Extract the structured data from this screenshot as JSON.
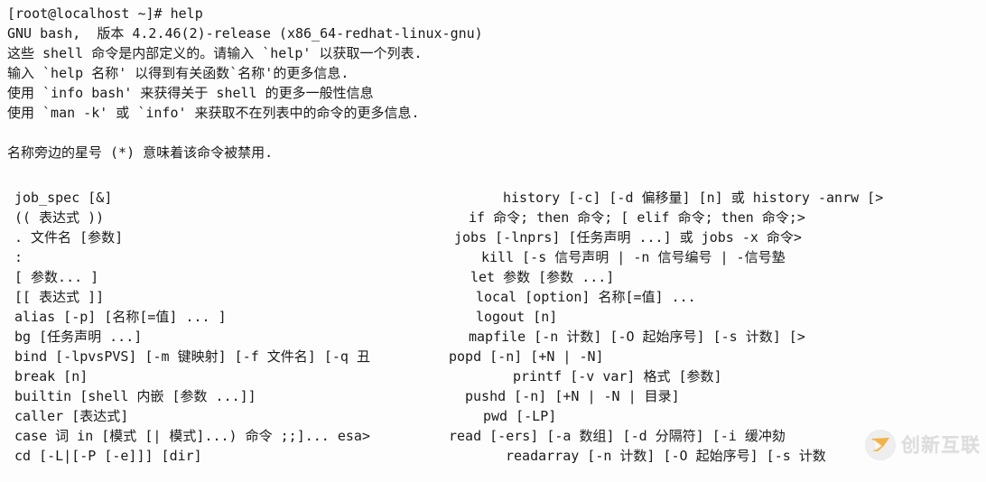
{
  "terminal": {
    "prompt_line": "[root@localhost ~]# help",
    "header_lines": [
      "GNU bash,  版本 4.2.46(2)-release (x86_64-redhat-linux-gnu)",
      "这些 shell 命令是内部定义的。请输入 `help' 以获取一个列表.",
      "输入 `help 名称' 以得到有关函数`名称'的更多信息.",
      "使用 `info bash' 来获得关于 shell 的更多一般性信息",
      "使用 `man -k' 或 `info' 来获取不在列表中的命令的更多信息."
    ],
    "note_line": "名称旁边的星号 (*) 意味着该命令被禁用.",
    "left_column": [
      "job_spec [&]",
      "(( 表达式 ))",
      ". 文件名 [参数]",
      ":",
      "[ 参数... ]",
      "[[ 表达式 ]]",
      "alias [-p] [名称[=值] ... ]",
      "bg [任务声明 ...]",
      "bind [-lpvsPVS] [-m 键映射] [-f 文件名] [-q 丑",
      "break [n]",
      "builtin [shell 内嵌 [参数 ...]]",
      "caller [表达式]",
      "case 词 in [模式 [| 模式]...) 命令 ;;]... esa>",
      "cd [-L|[-P [-e]]] [dir]"
    ],
    "right_column": [
      "history [-c] [-d 偏移量] [n] 或 history -anrw [>",
      "if 命令; then 命令; [ elif 命令; then 命令;>",
      "jobs [-lnprs] [任务声明 ...] 或 jobs -x 命令>",
      "kill [-s 信号声明 | -n 信号编号 | -信号墊",
      "let 参数 [参数 ...]",
      "local [option] 名称[=值] ...",
      "logout [n]",
      "mapfile [-n 计数] [-O 起始序号] [-s 计数] [>",
      "popd [-n] [+N | -N]",
      "printf [-v var] 格式 [参数]",
      "pushd [-n] [+N | -N | 目录]",
      "pwd [-LP]",
      "read [-ers] [-a 数组] [-d 分隔符] [-i 缓冲劾",
      "readarray [-n 计数] [-O 起始序号] [-s 计数"
    ],
    "right_column_offsets": [
      557,
      519,
      503,
      533,
      521,
      527,
      527,
      519,
      497,
      568,
      515,
      535,
      497,
      560
    ],
    "colors": {
      "background": "#fdfdfd",
      "foreground": "#1b1b1b"
    }
  },
  "watermark": {
    "text": "创新互联",
    "logo_color": "#f0a830"
  }
}
